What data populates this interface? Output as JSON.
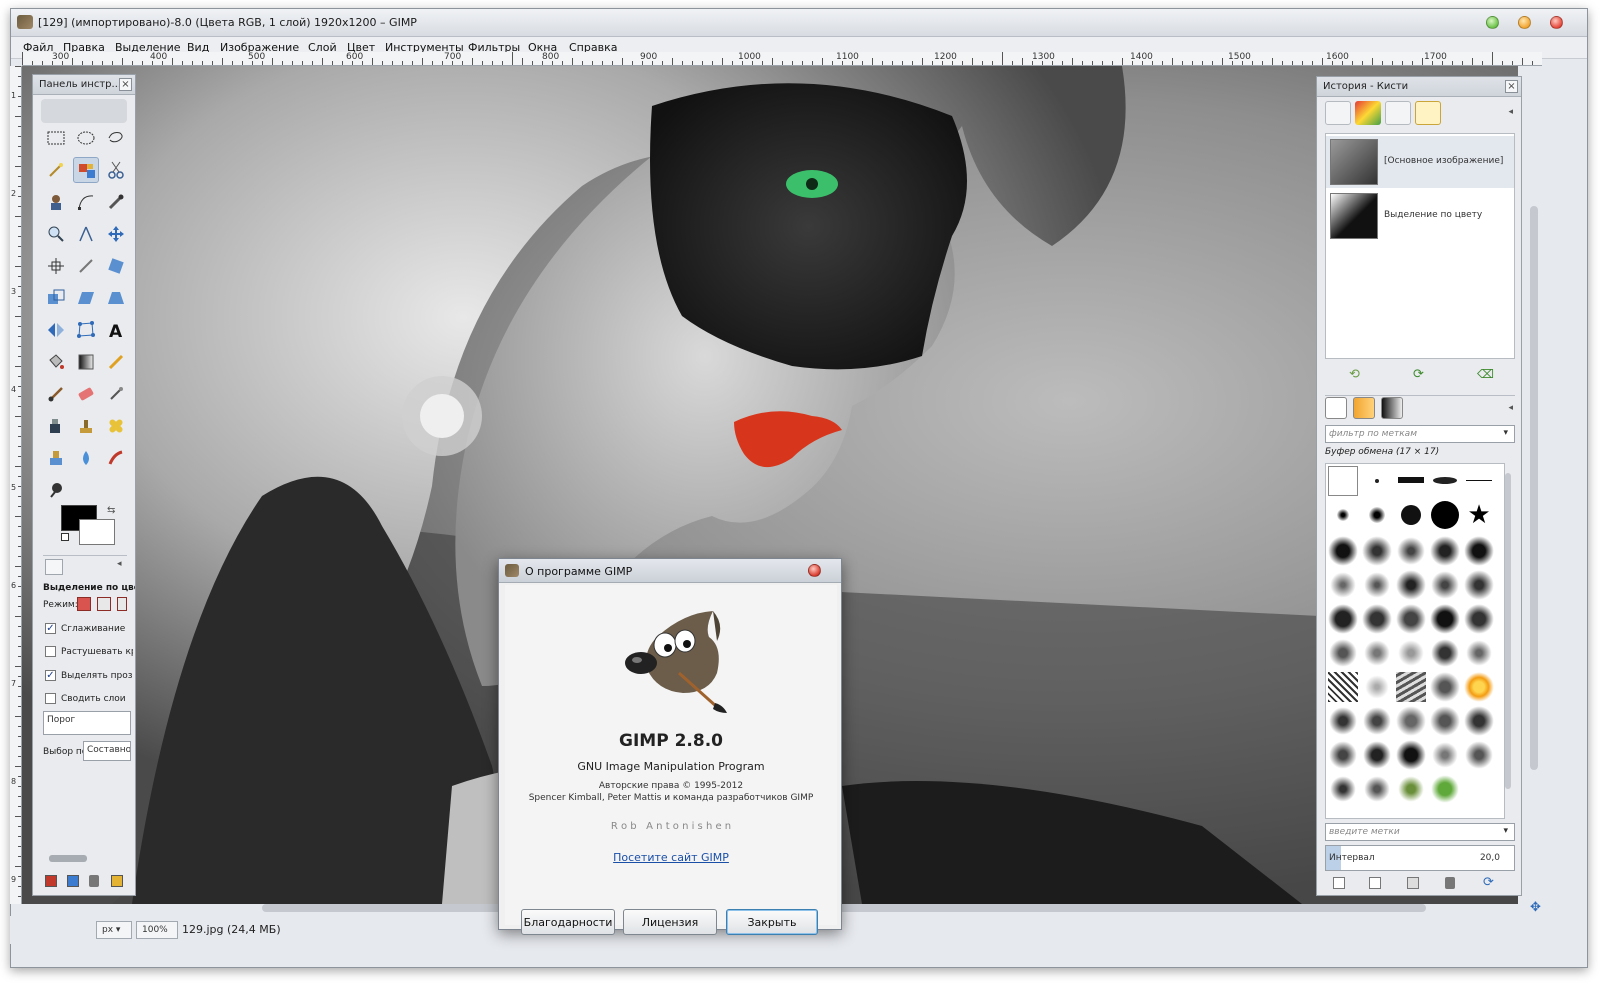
{
  "window": {
    "title": "[129] (импортировано)-8.0 (Цвета RGB, 1 слой) 1920x1200 – GIMP"
  },
  "menu": [
    "Файл",
    "Правка",
    "Выделение",
    "Вид",
    "Изображение",
    "Слой",
    "Цвет",
    "Инструменты",
    "Фильтры",
    "Окна",
    "Справка"
  ],
  "ruler": {
    "h_labels": [
      "300",
      "400",
      "500",
      "600",
      "700",
      "800",
      "900",
      "1000",
      "1100",
      "1200",
      "1300",
      "1400",
      "1500",
      "1600",
      "1700"
    ],
    "v_labels": [
      "1",
      "2",
      "3",
      "4",
      "5",
      "6",
      "7",
      "8",
      "9"
    ]
  },
  "toolbox": {
    "title": "Панель инстр...",
    "tool_options_title": "Выделение по цвет",
    "mode_label": "Режим:",
    "options": [
      {
        "label": "Сглаживание",
        "checked": true
      },
      {
        "label": "Растушевать кра",
        "checked": false
      },
      {
        "label": "Выделять прозр",
        "checked": true
      },
      {
        "label": "Сводить слои",
        "checked": false
      }
    ],
    "threshold_label": "Порог",
    "select_by_label": "Выбор по:",
    "select_by_value": "Составной"
  },
  "right_panel": {
    "title": "История - Кисти",
    "history": [
      {
        "label": "[Основное изображение]"
      },
      {
        "label": "Выделение по цвету"
      }
    ],
    "brush_filter_placeholder": "фильтр по меткам",
    "brush_name": "Буфер обмена (17 × 17)",
    "tags_placeholder": "введите метки",
    "spacing_label": "Интервал",
    "spacing_value": "20,0"
  },
  "status": {
    "unit": "px",
    "zoom": "100%",
    "file": "129.jpg (24,4 МБ)"
  },
  "dialog": {
    "title": "О программе GIMP",
    "app_name": "GIMP 2.8.0",
    "app_full": "GNU Image Manipulation Program",
    "copyright": "Авторские права © 1995-2012",
    "authors": "Spencer Kimball, Peter Mattis и команда разработчиков GIMP",
    "credit": "R o b   A n t o n i s h e n",
    "link": "Посетите сайт GIMP",
    "btn_thanks": "Благодарности",
    "btn_license": "Лицензия",
    "btn_close": "Закрыть"
  },
  "colors": {
    "accent": "#3c7fb1",
    "fg_color": "#000000",
    "bg_color": "#ffffff",
    "lips": "#d8361c",
    "eye": "#22b04a"
  }
}
